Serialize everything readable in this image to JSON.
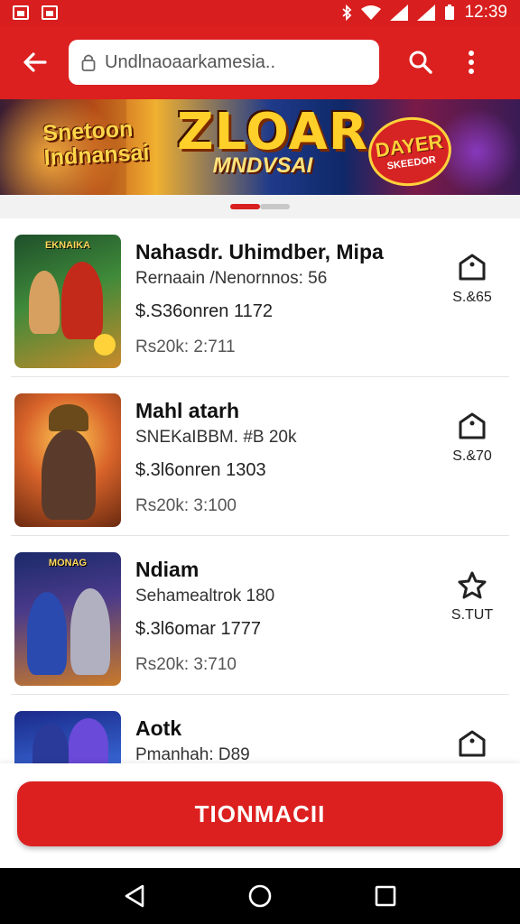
{
  "status_bar": {
    "time": "12:39"
  },
  "search": {
    "value": "Undlnaoaarkamesia.."
  },
  "banner": {
    "left_text_1": "Snetoon",
    "left_text_2": "Indnansai",
    "center_big": "ZLOAR",
    "center_small": "MNDVSAI",
    "badge_top": "DAYER",
    "badge_bottom": "SKEEDOR",
    "page_count": 2,
    "active_page": 1
  },
  "items": [
    {
      "title": "Nahasdr. Uhimdber, Mipa",
      "subtitle": "Rernaain /Nenornnos: 56",
      "price": "$.S36onren 1172",
      "extra": "Rs20k: 2:711",
      "side_value": "S.&65",
      "side_icon": "bag-icon",
      "thumb_caption": "EKNAIKA"
    },
    {
      "title": "Mahl atarh",
      "subtitle": "SNEKaIBBM. #B 20k",
      "price": "$.3l6onren 1303",
      "extra": "Rs20k: 3:100",
      "side_value": "S.&70",
      "side_icon": "bag-icon",
      "thumb_caption": ""
    },
    {
      "title": "Ndiam",
      "subtitle": "Sehamealtrok 180",
      "price": "$.3l6omar 1777",
      "extra": "Rs20k: 3:710",
      "side_value": "S.TUT",
      "side_icon": "star-icon",
      "thumb_caption": "MONAG"
    },
    {
      "title": "Aotk",
      "subtitle": "Pmanhah: D89",
      "price": "",
      "extra": "",
      "side_value": "",
      "side_icon": "bag-icon",
      "thumb_caption": ""
    }
  ],
  "cta": {
    "label": "TIONMACII"
  },
  "colors": {
    "primary": "#dc1f1f",
    "nav": "#000000"
  }
}
